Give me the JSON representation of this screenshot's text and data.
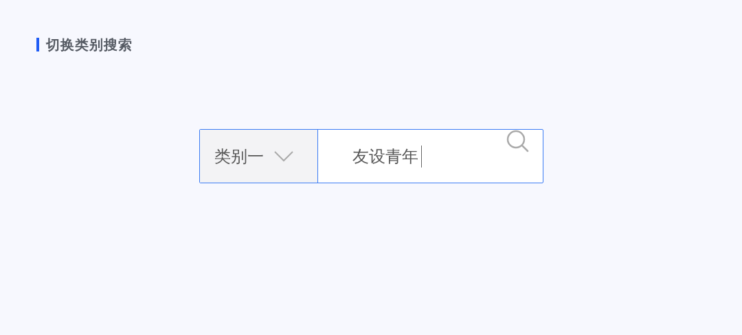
{
  "section": {
    "title": "切换类别搜索"
  },
  "search": {
    "category": "类别一",
    "value": "友设青年",
    "focused": true
  }
}
